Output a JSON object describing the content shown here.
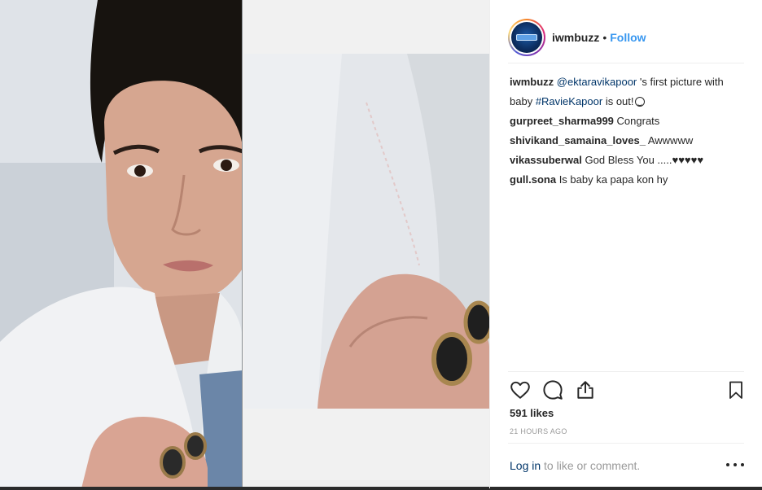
{
  "post": {
    "username": "iwmbuzz",
    "separator": "•",
    "follow_label": "Follow"
  },
  "comments": [
    {
      "user": "iwmbuzz",
      "parts": [
        {
          "type": "link",
          "text": "@ektaravikapoor"
        },
        {
          "type": "text",
          "text": " 's first picture with baby "
        },
        {
          "type": "link",
          "text": "#RavieKapoor"
        },
        {
          "type": "text",
          "text": " is out!"
        }
      ],
      "emoji": "smiley-emoji"
    },
    {
      "user": "gurpreet_sharma999",
      "text": "Congrats"
    },
    {
      "user": "shivikand_samaina_loves_",
      "text": "Awwwww"
    },
    {
      "user": "vikassuberwal",
      "text": "God Bless You .....♥♥♥♥♥"
    },
    {
      "user": "gull.sona",
      "text": "Is baby ka papa kon hy"
    }
  ],
  "actions": {
    "icons": [
      "heart-icon",
      "comment-icon",
      "share-icon",
      "bookmark-icon"
    ]
  },
  "likes_label": "591 likes",
  "timestamp": "21 HOURS AGO",
  "login": {
    "link_label": "Log in",
    "rest_label": " to like or comment."
  },
  "more_icon": "more-options-icon",
  "colors": {
    "link": "#003569",
    "follow": "#3897f0",
    "muted": "#999999",
    "text": "#262626"
  }
}
